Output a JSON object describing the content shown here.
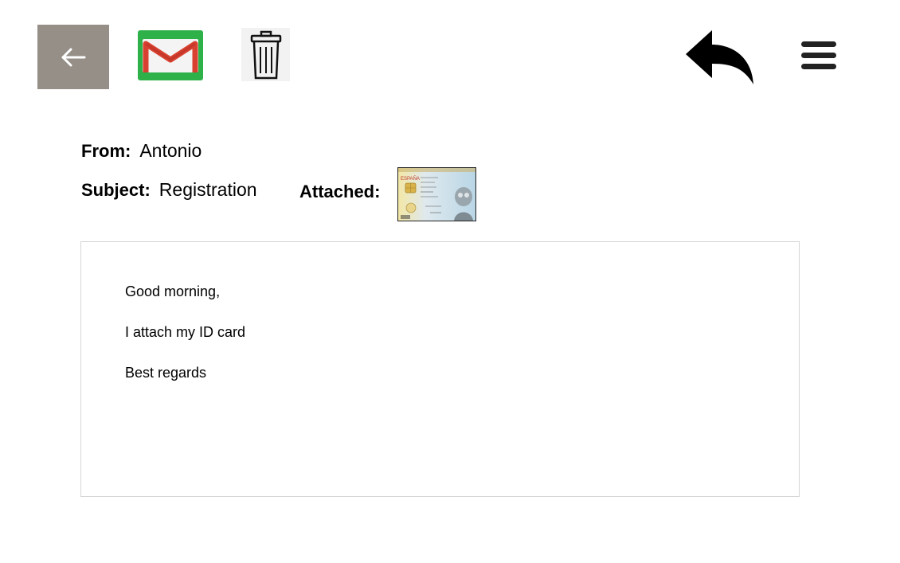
{
  "toolbar": {
    "back_icon": "arrow-left-icon",
    "app_icon": "gmail-icon",
    "delete_icon": "trash-icon",
    "reply_icon": "reply-arrow-icon",
    "menu_icon": "hamburger-menu-icon",
    "back_button_color": "#958f88",
    "gmail_bg_color": "#2fb14a"
  },
  "email": {
    "from_label": "From:",
    "from_value": "Antonio",
    "subject_label": "Subject:",
    "subject_value": "Registration",
    "attached_label": "Attached:",
    "attachment_icon": "id-card-thumbnail",
    "attachment_card_text": "ESPAÑA",
    "body_lines": [
      "Good morning,",
      "I attach my ID card",
      "Best regards"
    ]
  }
}
